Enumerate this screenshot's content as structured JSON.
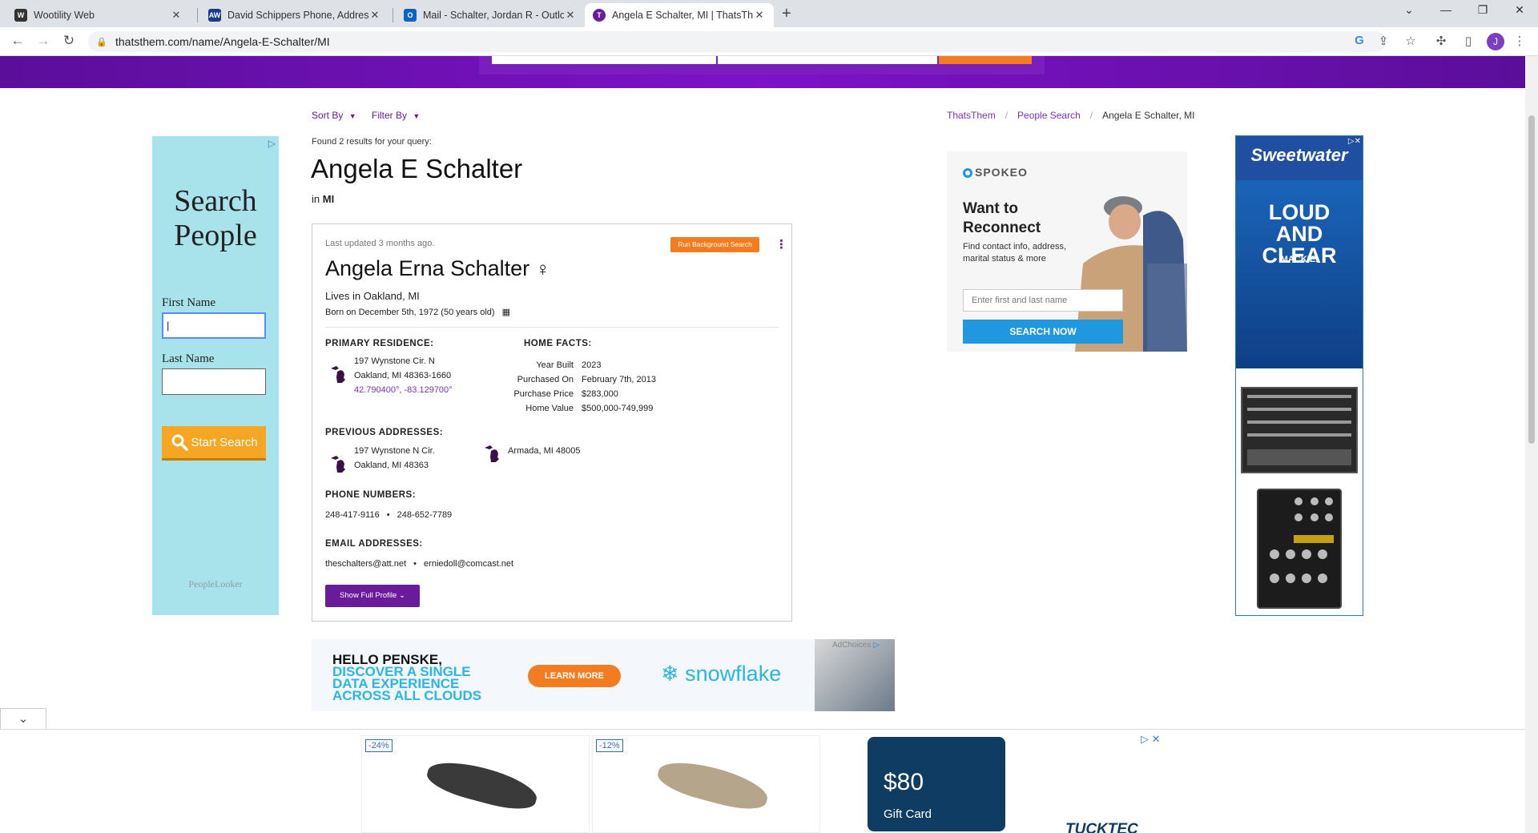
{
  "browser": {
    "tabs": [
      {
        "title": "Wootility Web",
        "active": false
      },
      {
        "title": "David Schippers Phone, Address",
        "active": false
      },
      {
        "title": "Mail - Schalter, Jordan R - Outloo",
        "active": false
      },
      {
        "title": "Angela E Schalter, MI | ThatsThem",
        "active": true
      }
    ],
    "url": "thatsthem.com/name/Angela-E-Schalter/MI",
    "profile_initial": "J"
  },
  "left_ad": {
    "title": "Search People",
    "first_name_label": "First Name",
    "last_name_label": "Last Name",
    "first_name_value": "|",
    "start_button": "Start Search",
    "brand": "PeopleLooker"
  },
  "results": {
    "sort_by": "Sort By",
    "filter_by": "Filter By",
    "found_text": "Found 2 results for your query:",
    "query_name": "Angela E Schalter",
    "in_prefix": "in",
    "state": "MI"
  },
  "breadcrumb": {
    "home": "ThatsThem",
    "people_search": "People Search",
    "current": "Angela E Schalter, MI"
  },
  "person": {
    "last_updated": "Last updated 3 months ago.",
    "background_button": "Run Background Search",
    "full_name": "Angela Erna Schalter",
    "gender_symbol": "♀",
    "lives_in": "Lives in Oakland, MI",
    "born": "Born on December 5th, 1972 (50 years old)",
    "primary_residence_heading": "PRIMARY RESIDENCE:",
    "primary_address_line1": "197 Wynstone Cir. N",
    "primary_address_line2": "Oakland, MI 48363-1660",
    "primary_coords": "42.790400°, -83.129700°",
    "home_facts_heading": "HOME FACTS:",
    "home_facts": [
      {
        "key": "Year Built",
        "value": "2023"
      },
      {
        "key": "Purchased On",
        "value": "February 7th, 2013"
      },
      {
        "key": "Purchase Price",
        "value": "$283,000"
      },
      {
        "key": "Home Value",
        "value": "$500,000-749,999"
      }
    ],
    "previous_addresses_heading": "PREVIOUS ADDRESSES:",
    "previous_addresses": [
      {
        "line1": "197 Wynstone N Cir.",
        "line2": "Oakland, MI 48363"
      },
      {
        "line1": "Armada, MI 48005",
        "line2": ""
      }
    ],
    "phone_heading": "PHONE NUMBERS:",
    "phones": [
      "248-417-9116",
      "248-652-7789"
    ],
    "email_heading": "EMAIL ADDRESSES:",
    "emails": [
      "theschalters@att.net",
      "erniedoll@comcast.net"
    ],
    "bullet": "•",
    "full_profile_button": "Show Full Profile"
  },
  "spokeo_ad": {
    "brand": "SPOKEO",
    "headline_line1": "Want to",
    "headline_line2": "Reconnect",
    "description": "Find contact info, address, marital status & more",
    "input_placeholder": "Enter first and last name",
    "button": "SEARCH NOW"
  },
  "right_ad": {
    "brand": "Sweetwater",
    "headline_line1": "LOUD",
    "headline_line2": "AND CLEAR",
    "sub_brand": "MACKIE."
  },
  "snowflake_ad": {
    "line1": "HELLO PENSKE,",
    "line2": "DISCOVER A SINGLE",
    "line3": "DATA EXPERIENCE",
    "line4": "ACROSS ALL CLOUDS",
    "button": "LEARN MORE",
    "brand": "snowflake",
    "adchoices": "AdChoices"
  },
  "bottom_ad": {
    "discount1": "-24%",
    "discount2": "-12%",
    "gift_amount": "$80",
    "gift_label": "Gift Card",
    "brand": "TUCKTEC"
  },
  "colors": {
    "brand_purple": "#6a1b9a",
    "accent_orange": "#f47c20",
    "link_purple": "#7b2fbf"
  }
}
